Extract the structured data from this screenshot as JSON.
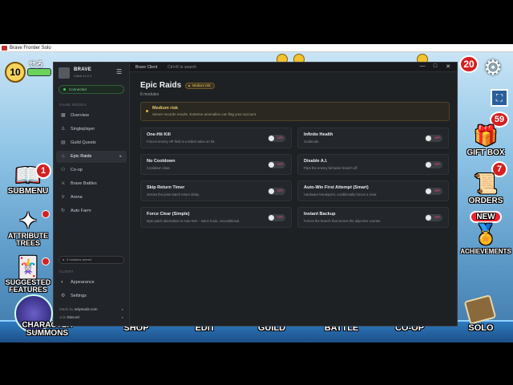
{
  "game_window": {
    "title": "Brave Frontier Solo",
    "hud": {
      "level": "10",
      "name": "せろ",
      "notif_count": "20"
    },
    "left_menu": [
      {
        "label": "SUBMENU",
        "badge": "1"
      },
      {
        "label": "ATTRIBUTE TREES",
        "badge": ""
      },
      {
        "label": "SUGGESTED FEATURES",
        "badge": ""
      }
    ],
    "right_menu": [
      {
        "label": "GIFT BOX",
        "badge": "59"
      },
      {
        "label": "ORDERS",
        "badge": "7"
      },
      {
        "label": "ACHIEVEMENTS",
        "tag": "NEW"
      }
    ],
    "bottom_nav": [
      "CHARACTER SUMMONS",
      "SHOP",
      "EDIT",
      "GUILD",
      "BATTLE",
      "CO-OP",
      "SOLO"
    ]
  },
  "client": {
    "titlebar": {
      "title": "Brave Client",
      "search_hint": "Ctrl+K to search",
      "minimize": "—",
      "maximize": "□",
      "close": "✕"
    },
    "brand": {
      "name": "BRAVE",
      "version": "Client v1.0.1"
    },
    "connection": "Connected",
    "sections": {
      "game_modes": "GAME MODES",
      "client": "CLIENT"
    },
    "nav": [
      {
        "label": "Overview",
        "icon": "grid-icon"
      },
      {
        "label": "Singleplayer",
        "icon": "user-icon"
      },
      {
        "label": "Guild Quests",
        "icon": "scroll-icon"
      },
      {
        "label": "Epic Raids",
        "icon": "flame-icon",
        "active": true
      },
      {
        "label": "Co-op",
        "icon": "users-icon"
      },
      {
        "label": "Brave Battles",
        "icon": "swords-icon"
      },
      {
        "label": "Arena",
        "icon": "trophy-icon"
      },
      {
        "label": "Auto Farm",
        "icon": "repeat-icon"
      }
    ],
    "armed": "0 modules armed",
    "client_nav": [
      {
        "label": "Appearance",
        "icon": "palette-icon"
      },
      {
        "label": "Settings",
        "icon": "gear-icon"
      }
    ],
    "footer": {
      "made_by_label": "Made by",
      "made_by": "onlymodz.com",
      "join_label": "Join",
      "join": "Discord"
    },
    "page": {
      "title": "Epic Raids",
      "risk": "Medium risk",
      "subtitle": "8 modules",
      "banner_title": "Medium risk",
      "banner_desc": "Server records results. Extreme anomalies can flag your account."
    },
    "toggle_off": "OFF",
    "modules": [
      {
        "title": "One-Hit Kill",
        "desc": "Forces enemy HP field to a lethal value on hit."
      },
      {
        "title": "Infinite Health",
        "desc": "Godmode."
      },
      {
        "title": "No Cooldown",
        "desc": "Cooldown clear."
      },
      {
        "title": "Disable A.I.",
        "desc": "Flips the enemy behavior branch off."
      },
      {
        "title": "Skip Return Timer",
        "desc": "Zeroes the post-match return delay."
      },
      {
        "title": "Auto-Win First Attempt (Smart)",
        "desc": "Hardware breakpoint, conditionally forces a clear."
      },
      {
        "title": "Force Clear (Simple)",
        "desc": "Byte patch alternative to Auto-Win – same hook, unconditional."
      },
      {
        "title": "Instant Backup",
        "desc": "Forces the branch that zeroes the objective counter."
      }
    ]
  }
}
